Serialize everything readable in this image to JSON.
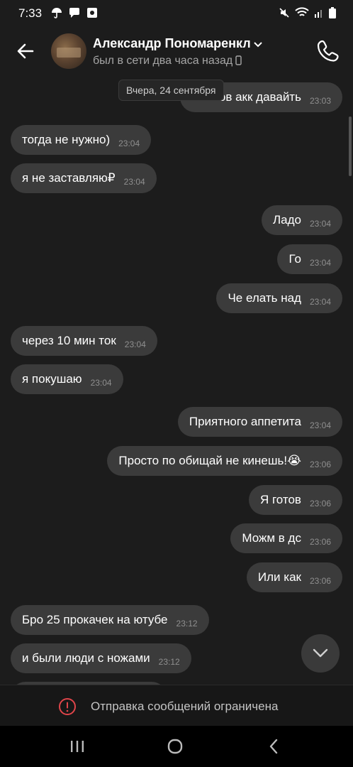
{
  "status_bar": {
    "time": "7:33"
  },
  "header": {
    "contact_name": "Александр Пономаренкл",
    "contact_status": "был в сети два часа назад"
  },
  "chat": {
    "date_chip": "Вчера, 24 сентября",
    "messages": [
      {
        "dir": "out",
        "text": "Вольов акк давайть",
        "time": "23:03"
      },
      {
        "dir": "in",
        "text": "тогда не нужно)",
        "time": "23:04"
      },
      {
        "dir": "in",
        "text": "я не заставляю₽",
        "time": "23:04"
      },
      {
        "dir": "out",
        "text": "Ладо",
        "time": "23:04"
      },
      {
        "dir": "out",
        "text": "Го",
        "time": "23:04"
      },
      {
        "dir": "out",
        "text": "Че елать над",
        "time": "23:04"
      },
      {
        "dir": "in",
        "text": "через 10 мин ток",
        "time": "23:04"
      },
      {
        "dir": "in",
        "text": "я покушаю",
        "time": "23:04"
      },
      {
        "dir": "out",
        "text": "Приятного аппетита",
        "time": "23:04"
      },
      {
        "dir": "out",
        "text": "Просто по обищай не кинешь!😭",
        "time": "23:06"
      },
      {
        "dir": "out",
        "text": "Я готов",
        "time": "23:06"
      },
      {
        "dir": "out",
        "text": "Можм в дс",
        "time": "23:06"
      },
      {
        "dir": "out",
        "text": "Или как",
        "time": "23:06"
      },
      {
        "dir": "in",
        "text": "Бро 25 прокачек на ютубе",
        "time": "23:12"
      },
      {
        "dir": "in",
        "text": "и были люди с ножами",
        "time": "23:12"
      }
    ]
  },
  "restricted_banner": {
    "text": "Отправка сообщений ограничена"
  },
  "icons": {
    "back": "arrow-left-icon",
    "call": "phone-icon",
    "scroll": "chevron-down-icon",
    "warning": "exclamation-circle-icon"
  },
  "colors": {
    "accent_warning": "#e0454a",
    "bubble": "#3b3b3b",
    "background": "#1c1c1c"
  }
}
